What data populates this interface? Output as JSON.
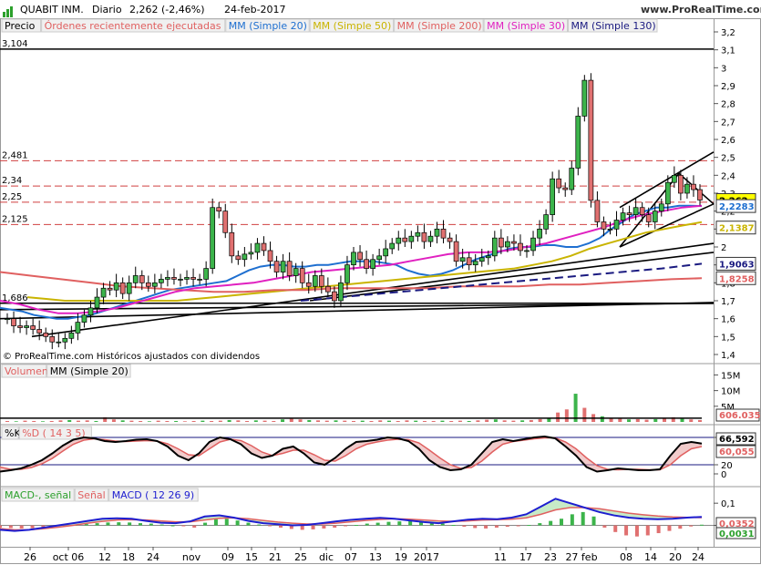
{
  "header": {
    "symbol": "QUABIT INM.",
    "period": "Diario",
    "quote": "2,262 (-2,46%)",
    "date": "24-feb-2017",
    "site": "www.ProRealTime.com"
  },
  "price_panel": {
    "legend": [
      {
        "label": "Precio",
        "color": "#000000"
      },
      {
        "label": "Órdenes recientemente ejecutadas",
        "color": "#e06060"
      },
      {
        "label": "MM (Simple 20)",
        "color": "#1e6fd0"
      },
      {
        "label": "MM (Simple 50)",
        "color": "#c9b400"
      },
      {
        "label": "MM (Simple 200)",
        "color": "#e06060"
      },
      {
        "label": "MM (Simple 30)",
        "color": "#e020c0"
      },
      {
        "label": "MM (Simple 130)",
        "color": "#1a1a80"
      }
    ],
    "level_labels": [
      "3,104",
      "2,481",
      "2,34",
      "2,25",
      "2,125",
      "1,686"
    ],
    "right_badges": [
      {
        "text": "2,262",
        "bg": "#ffff00",
        "fg": "#000000"
      },
      {
        "text": "2,2283",
        "bg": "#ffffff",
        "fg": "#1e6fd0"
      },
      {
        "text": "2,1387",
        "bg": "#ffffff",
        "fg": "#c9b400"
      },
      {
        "text": "1,9063",
        "bg": "#ffffff",
        "fg": "#1a1a80"
      },
      {
        "text": "1,8258",
        "bg": "#ffffff",
        "fg": "#e06060"
      }
    ],
    "footer": "© ProRealTime.com  Históricos ajustados con dividendos"
  },
  "volume_panel": {
    "legend": [
      {
        "label": "Volumen",
        "color": "#e06060"
      },
      {
        "label": "MM (Simple 20)",
        "color": "#000000"
      }
    ],
    "badge": "606.035"
  },
  "stoch_panel": {
    "legend": [
      {
        "label": "%K",
        "color": "#000000"
      },
      {
        "label": "%D ( 14 3 5)",
        "color": "#e06060"
      }
    ],
    "badges": [
      "66,592",
      "60,055"
    ]
  },
  "macd_panel": {
    "legend": [
      {
        "label": "MACD-, señal",
        "color": "#2ca02c"
      },
      {
        "label": "Señal",
        "color": "#e06060"
      },
      {
        "label": "MACD ( 12 26 9)",
        "color": "#1e1ed0"
      }
    ],
    "badges": [
      "0,0352",
      "0,0031"
    ]
  },
  "chart_data": [
    {
      "type": "line",
      "title": "QUABIT INM. Diario",
      "x_ticks": [
        "26",
        "oct 06",
        "12",
        "18",
        "24",
        "nov",
        "09",
        "15",
        "21",
        "25",
        "dic",
        "07",
        "13",
        "19",
        "2017",
        "11",
        "17",
        "23",
        "27 feb",
        "08",
        "14",
        "20",
        "24"
      ],
      "y_ticks": [
        "3,2",
        "3,1",
        "3",
        "2,9",
        "2,8",
        "2,7",
        "2,6",
        "2,5",
        "2,4",
        "2,3",
        "2,2",
        "2,1",
        "2",
        "1,9",
        "1,8",
        "1,7",
        "1,6",
        "1,5",
        "1,4"
      ],
      "ylim": [
        1.4,
        3.25
      ],
      "series": [
        {
          "name": "Precio",
          "values": [
            1.6,
            1.56,
            1.55,
            1.56,
            1.54,
            1.52,
            1.5,
            1.47,
            1.47,
            1.49,
            1.52,
            1.58,
            1.62,
            1.66,
            1.72,
            1.77,
            1.76,
            1.8,
            1.74,
            1.8,
            1.84,
            1.8,
            1.78,
            1.8,
            1.82,
            1.83,
            1.82,
            1.82,
            1.83,
            1.82,
            1.82,
            1.88,
            2.22,
            2.2,
            2.08,
            1.95,
            1.93,
            1.96,
            1.97,
            2.02,
            1.98,
            1.92,
            1.86,
            1.92,
            1.84,
            1.88,
            1.8,
            1.78,
            1.84,
            1.78,
            1.75,
            1.7,
            1.8,
            1.9,
            1.97,
            1.93,
            1.88,
            1.93,
            1.95,
            1.99,
            2.02,
            2.05,
            2.03,
            2.06,
            2.08,
            2.03,
            2.06,
            2.1,
            2.05,
            2.03,
            1.92,
            1.94,
            1.9,
            1.92,
            1.94,
            1.95,
            2.05,
            2.0,
            2.03,
            2.02,
            1.98,
            1.98,
            2.05,
            2.1,
            2.18,
            2.38,
            2.33,
            2.32,
            2.44,
            2.73,
            2.93,
            2.26,
            2.14,
            2.1,
            2.1,
            2.15,
            2.19,
            2.18,
            2.22,
            2.18,
            2.14,
            2.2,
            2.24,
            2.36,
            2.4,
            2.3,
            2.35,
            2.32,
            2.262
          ]
        },
        {
          "name": "MM (Simple 20)",
          "values": [
            1.66,
            1.65,
            1.64,
            1.62,
            1.61,
            1.6,
            1.6,
            1.61,
            1.62,
            1.64,
            1.66,
            1.68,
            1.7,
            1.72,
            1.74,
            1.76,
            1.77,
            1.78,
            1.79,
            1.8,
            1.81,
            1.84,
            1.87,
            1.89,
            1.9,
            1.9,
            1.89,
            1.89,
            1.9,
            1.9,
            1.91,
            1.92,
            1.92,
            1.92,
            1.91,
            1.9,
            1.87,
            1.85,
            1.84,
            1.85,
            1.87,
            1.9,
            1.93,
            1.95,
            1.97,
            1.99,
            2.0,
            2.0,
            2.01,
            2.01,
            2.0,
            2.0,
            2.02,
            2.05,
            2.1,
            2.14,
            2.18,
            2.2,
            2.22,
            2.22,
            2.23,
            2.23,
            2.2283
          ]
        },
        {
          "name": "MM (Simple 50)",
          "values": [
            1.72,
            1.71,
            1.7,
            1.7,
            1.7,
            1.7,
            1.7,
            1.7,
            1.7,
            1.71,
            1.72,
            1.73,
            1.74,
            1.75,
            1.76,
            1.77,
            1.78,
            1.79,
            1.8,
            1.81,
            1.82,
            1.83,
            1.84,
            1.85,
            1.86,
            1.87,
            1.88,
            1.9,
            1.92,
            1.95,
            1.99,
            2.02,
            2.05,
            2.08,
            2.1,
            2.12,
            2.1387
          ]
        },
        {
          "name": "MM (Simple 200)",
          "values": [
            1.86,
            1.84,
            1.82,
            1.8,
            1.78,
            1.77,
            1.76,
            1.75,
            1.75,
            1.76,
            1.76,
            1.77,
            1.77,
            1.77,
            1.77,
            1.78,
            1.78,
            1.78,
            1.79,
            1.79,
            1.8,
            1.81,
            1.82,
            1.8258
          ]
        },
        {
          "name": "MM (Simple 30)",
          "values": [
            1.7,
            1.68,
            1.65,
            1.63,
            1.63,
            1.64,
            1.66,
            1.69,
            1.72,
            1.75,
            1.77,
            1.78,
            1.79,
            1.8,
            1.82,
            1.84,
            1.86,
            1.87,
            1.88,
            1.89,
            1.9,
            1.92,
            1.94,
            1.96,
            1.97,
            1.97,
            1.98,
            2.0,
            2.02,
            2.05,
            2.08,
            2.11,
            2.15,
            2.18,
            2.2,
            2.22,
            2.23
          ]
        },
        {
          "name": "MM (Simple 130)",
          "values": [
            1.7,
            1.72,
            1.74,
            1.76,
            1.78,
            1.8,
            1.82,
            1.84,
            1.86,
            1.88,
            1.9063
          ]
        }
      ]
    },
    {
      "type": "bar",
      "title": "Volumen",
      "y_ticks": [
        "15M",
        "10M",
        "5M"
      ],
      "ylim": [
        0,
        16
      ],
      "values": [
        0.3,
        0.2,
        0.4,
        0.3,
        0.2,
        0.3,
        0.5,
        0.6,
        0.4,
        0.5,
        0.3,
        1.5,
        0.8,
        0.5,
        0.4,
        0.3,
        0.2,
        0.4,
        0.3,
        0.3,
        0.2,
        0.3,
        0.4,
        0.3,
        0.4,
        0.6,
        0.5,
        0.3,
        0.5,
        0.4,
        0.3,
        0.8,
        1.0,
        0.8,
        0.6,
        0.5,
        0.4,
        0.5,
        0.4,
        0.3,
        0.4,
        0.3,
        0.5,
        0.4,
        0.3,
        0.5,
        0.4,
        0.3,
        0.3,
        0.4,
        0.3,
        0.4,
        0.3,
        0.5,
        0.7,
        0.8,
        0.5,
        0.4,
        0.5,
        0.6,
        0.9,
        1.2,
        3.0,
        4.0,
        9.0,
        4.5,
        2.5,
        1.8,
        1.2,
        1.0,
        0.8,
        0.9,
        0.7,
        0.9,
        1.2,
        1.5,
        1.0,
        0.8,
        0.606
      ],
      "ma": 1.2
    },
    {
      "type": "line",
      "title": "%K %D ( 14 3 5)",
      "y_ticks": [
        "80",
        "20",
        "0"
      ],
      "ylim": [
        -10,
        100
      ],
      "series": [
        {
          "name": "%K",
          "values": [
            5,
            8,
            12,
            20,
            30,
            45,
            62,
            75,
            80,
            78,
            72,
            70,
            72,
            75,
            76,
            72,
            60,
            40,
            30,
            45,
            70,
            80,
            76,
            65,
            45,
            35,
            40,
            55,
            60,
            45,
            25,
            20,
            35,
            55,
            70,
            72,
            75,
            80,
            78,
            72,
            55,
            30,
            15,
            8,
            10,
            20,
            45,
            70,
            76,
            72,
            76,
            80,
            82,
            78,
            60,
            40,
            15,
            5,
            8,
            12,
            10,
            8,
            8,
            10,
            40,
            66,
            70,
            66.592
          ]
        },
        {
          "name": "%D",
          "values": [
            15,
            10,
            10,
            14,
            22,
            34,
            50,
            65,
            74,
            77,
            75,
            72,
            71,
            72,
            73,
            72,
            66,
            55,
            42,
            40,
            55,
            70,
            76,
            73,
            62,
            48,
            40,
            45,
            52,
            52,
            42,
            30,
            28,
            40,
            55,
            65,
            70,
            74,
            76,
            75,
            68,
            52,
            35,
            20,
            12,
            14,
            28,
            48,
            65,
            71,
            74,
            77,
            79,
            79,
            70,
            55,
            35,
            18,
            10,
            9,
            10,
            10,
            9,
            9,
            20,
            40,
            55,
            60.055
          ]
        }
      ]
    },
    {
      "type": "bar",
      "title": "MACD ( 12 26 9)",
      "y_ticks": [
        "0,1",
        "0"
      ],
      "ylim": [
        -0.08,
        0.15
      ],
      "histogram": [
        -0.01,
        -0.012,
        -0.014,
        -0.013,
        -0.01,
        -0.006,
        -0.002,
        0.002,
        0.006,
        0.01,
        0.013,
        0.014,
        0.013,
        0.01,
        0.008,
        0.004,
        0.0,
        -0.004,
        -0.01,
        0.012,
        0.028,
        0.03,
        0.022,
        0.012,
        0.004,
        -0.002,
        -0.01,
        -0.016,
        -0.02,
        -0.018,
        -0.014,
        -0.01,
        -0.004,
        0.002,
        0.008,
        0.012,
        0.016,
        0.018,
        0.02,
        0.018,
        0.014,
        0.008,
        0.002,
        -0.006,
        -0.012,
        -0.014,
        -0.01,
        -0.006,
        -0.002,
        0.002,
        0.01,
        0.02,
        0.03,
        0.05,
        0.06,
        0.04,
        -0.01,
        -0.03,
        -0.045,
        -0.05,
        -0.045,
        -0.035,
        -0.025,
        -0.015,
        -0.005,
        0.0031
      ],
      "series": [
        {
          "name": "MACD",
          "values": [
            -0.02,
            -0.025,
            -0.02,
            -0.01,
            0.0,
            0.01,
            0.02,
            0.03,
            0.032,
            0.03,
            0.02,
            0.012,
            0.01,
            0.018,
            0.04,
            0.045,
            0.035,
            0.02,
            0.01,
            0.005,
            0.0,
            0.002,
            0.01,
            0.018,
            0.025,
            0.03,
            0.034,
            0.03,
            0.022,
            0.015,
            0.01,
            0.018,
            0.026,
            0.03,
            0.028,
            0.035,
            0.05,
            0.085,
            0.12,
            0.1,
            0.08,
            0.06,
            0.045,
            0.035,
            0.03,
            0.028,
            0.03,
            0.035,
            0.0382
          ]
        },
        {
          "name": "Señal",
          "values": [
            -0.015,
            -0.02,
            -0.02,
            -0.015,
            -0.008,
            0.0,
            0.01,
            0.018,
            0.024,
            0.026,
            0.024,
            0.02,
            0.016,
            0.016,
            0.024,
            0.032,
            0.034,
            0.03,
            0.022,
            0.015,
            0.01,
            0.006,
            0.006,
            0.01,
            0.016,
            0.022,
            0.027,
            0.03,
            0.028,
            0.024,
            0.02,
            0.018,
            0.02,
            0.024,
            0.026,
            0.028,
            0.034,
            0.05,
            0.07,
            0.08,
            0.08,
            0.075,
            0.065,
            0.055,
            0.048,
            0.042,
            0.038,
            0.036,
            0.0352
          ]
        }
      ]
    }
  ]
}
